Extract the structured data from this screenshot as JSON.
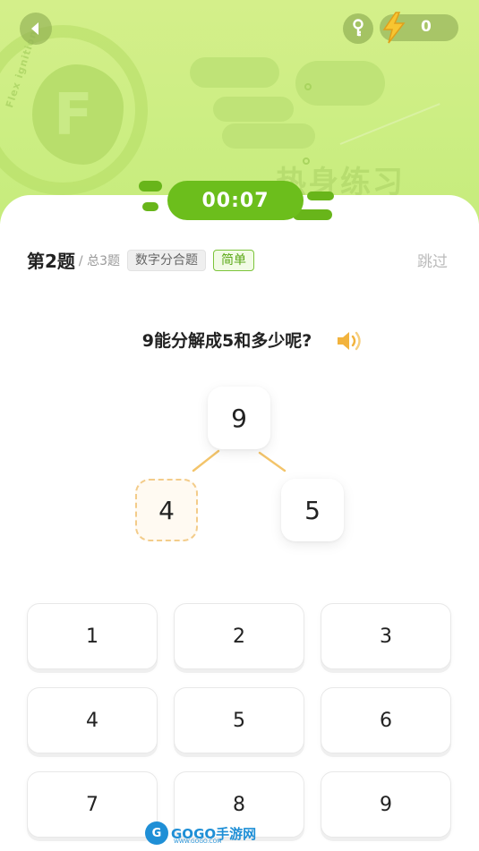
{
  "header": {
    "energy_count": "0",
    "bg_badge_text": "Flex ignition",
    "bg_title": "热身练习"
  },
  "timer": {
    "value": "00:07"
  },
  "question_bar": {
    "number": "第2题",
    "total": "/ 总3题",
    "type_tag": "数字分合题",
    "level_tag": "简单",
    "skip_label": "跳过"
  },
  "question": {
    "text": "9能分解成5和多少呢?"
  },
  "tree": {
    "top": "9",
    "left": "4",
    "right": "5"
  },
  "keypad": {
    "keys": [
      "1",
      "2",
      "3",
      "4",
      "5",
      "6",
      "7",
      "8",
      "9"
    ]
  },
  "watermark": {
    "text": "GOGO手游网",
    "sub": "WWW.GOGO.COM",
    "circle": "G"
  },
  "colors": {
    "header_green": "#cdee84",
    "timer_green": "#6cbe1c",
    "level_green": "#5aa816",
    "answer_border": "#f3cc8a",
    "speaker_orange": "#f2b33d",
    "bolt_yellow": "#f7c531"
  },
  "icons": [
    "back-arrow-icon",
    "key-icon",
    "lightning-bolt-icon",
    "speaker-icon"
  ]
}
